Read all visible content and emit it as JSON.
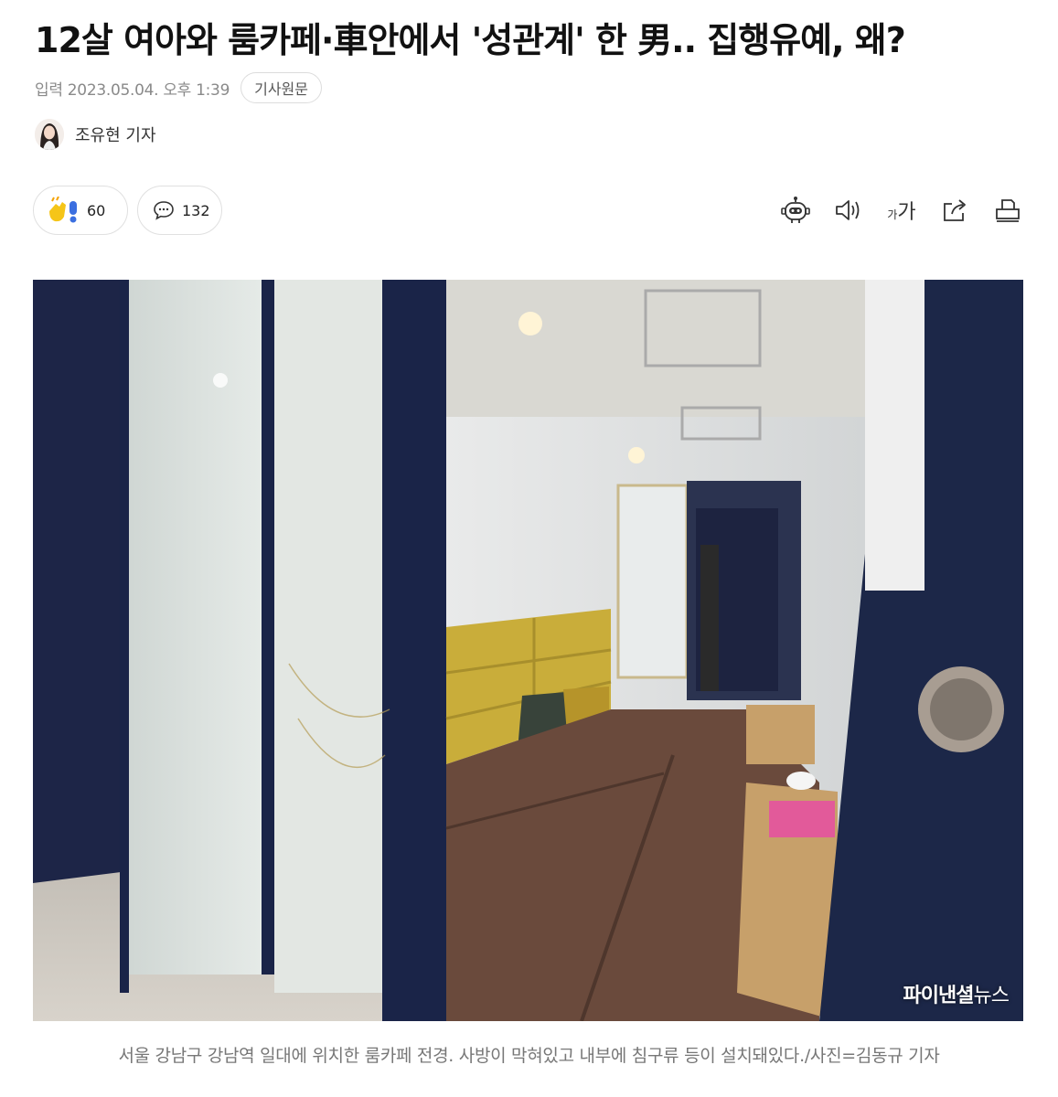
{
  "article": {
    "title": "12살 여아와 룸카페·車안에서 '성관계' 한 男.. 집행유예, 왜?",
    "date": "입력 2023.05.04. 오후 1:39",
    "origin_label": "기사원문",
    "author": "조유현 기자"
  },
  "reactions": {
    "like_count": "60",
    "comment_count": "132"
  },
  "toolbar": {
    "font_small": "가",
    "font_large": "가"
  },
  "icons": [
    "robot-icon",
    "speaker-icon",
    "font-size-icon",
    "share-icon",
    "print-icon"
  ],
  "photo": {
    "watermark_bold": "파이낸셜",
    "watermark_light": "뉴스",
    "caption": "서울 강남구 강남역 일대에 위치한 룸카페 전경. 사방이 막혀있고 내부에 침구류 등이 설치돼있다./사진=김동규 기자"
  },
  "colors": {
    "title": "#111111",
    "meta": "#8a8a8a",
    "caption": "#777777",
    "like_yellow": "#f5c518",
    "like_blue": "#3b6fe0"
  }
}
